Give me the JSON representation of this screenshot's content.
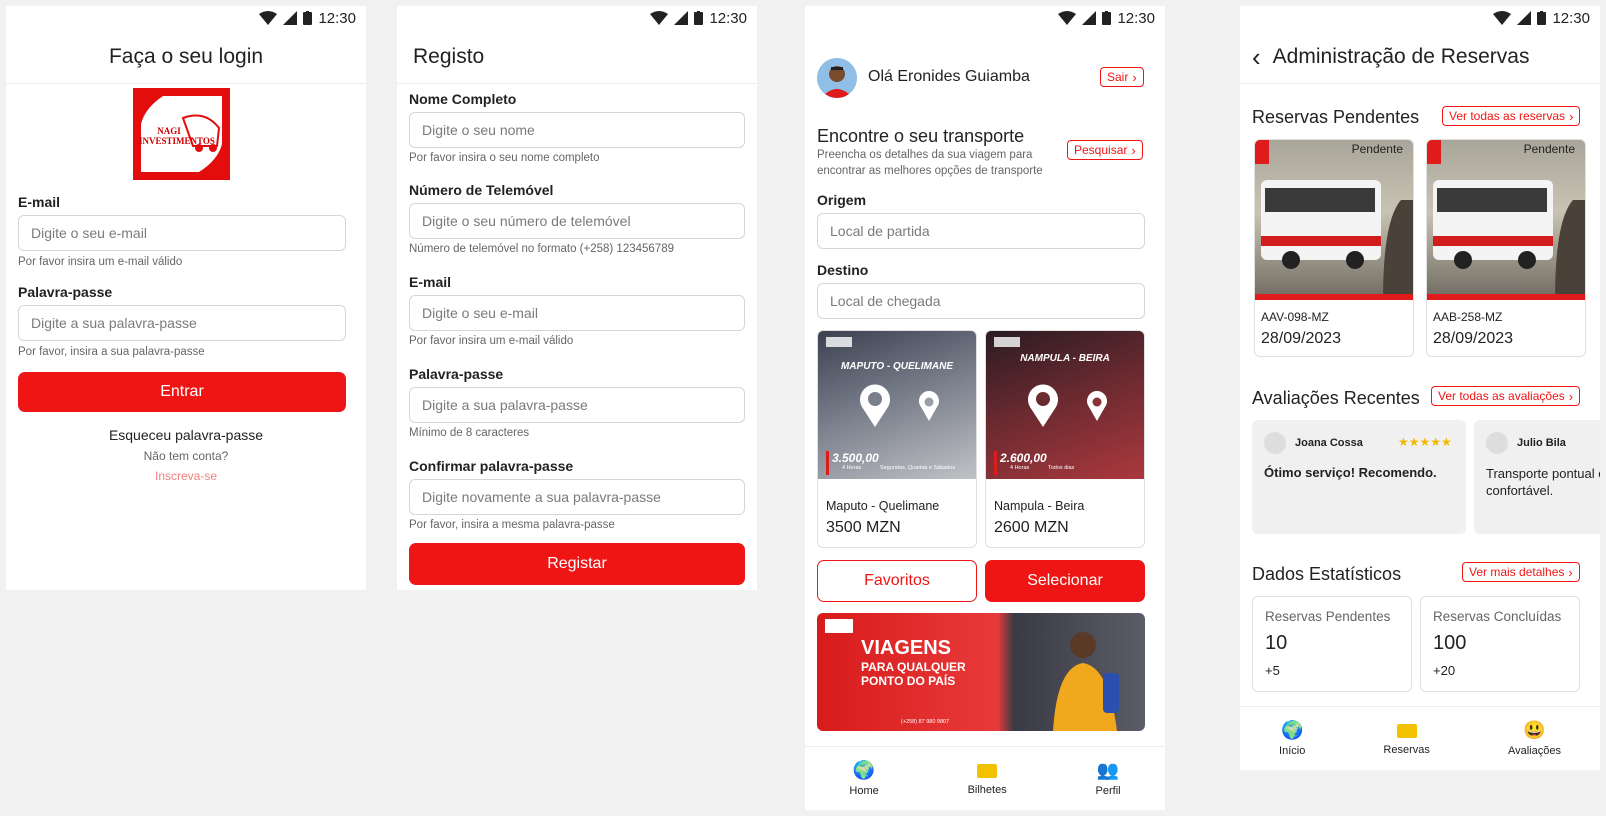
{
  "status": {
    "time": "12:30"
  },
  "login": {
    "title": "Faça o seu login",
    "logo_text": "Nagi Investimentos",
    "email_label": "E-mail",
    "email_placeholder": "Digite o seu e-mail",
    "email_help": "Por favor insira um e-mail válido",
    "password_label": "Palavra-passe",
    "password_placeholder": "Digite a sua palavra-passe",
    "password_help": "Por favor, insira a sua palavra-passe",
    "submit": "Entrar",
    "forgot": "Esqueceu palavra-passe",
    "no_account": "Não tem conta?",
    "signup": "Inscreva-se"
  },
  "register": {
    "title": "Registo",
    "name_label": "Nome Completo",
    "name_placeholder": "Digite o seu nome",
    "name_help": "Por favor insira o seu nome completo",
    "phone_label": "Número de Telemóvel",
    "phone_placeholder": "Digite o seu número de telemóvel",
    "phone_help": "Número de telemóvel no formato (+258) 123456789",
    "email_label": "E-mail",
    "email_placeholder": "Digite o seu e-mail",
    "email_help": "Por favor insira um e-mail válido",
    "password_label": "Palavra-passe",
    "password_placeholder": "Digite a sua palavra-passe",
    "password_help": "Mínimo de 8 caracteres",
    "confirm_label": "Confirmar palavra-passe",
    "confirm_placeholder": "Digite novamente a sua palavra-passe",
    "confirm_help": "Por favor, insira a mesma palavra-passe",
    "submit": "Registar"
  },
  "home": {
    "greeting": "Olá Eronides Guiamba",
    "logout": "Sair",
    "find_title": "Encontre o seu transporte",
    "find_sub": "Preencha os detalhes da sua viagem para encontrar as melhores opções de transporte",
    "search": "Pesquisar",
    "origin_label": "Origem",
    "origin_placeholder": "Local de partida",
    "dest_label": "Destino",
    "dest_placeholder": "Local de chegada",
    "routes": [
      {
        "banner_title": "MAPUTO - QUELIMANE",
        "banner_price": "3.500,00",
        "banner_duration": "4 Horas",
        "banner_days": "Segundas, Quartas e Sábados",
        "name": "Maputo - Quelimane",
        "price": "3500 MZN"
      },
      {
        "banner_title": "NAMPULA - BEIRA",
        "banner_price": "2.600,00",
        "banner_duration": "4 Horas",
        "banner_days": "Todos dias",
        "name": "Nampula - Beira",
        "price": "2600 MZN"
      }
    ],
    "favorites": "Favoritos",
    "select": "Selecionar",
    "promo_line1": "VIAGENS",
    "promo_line2": "PARA QUALQUER",
    "promo_line3": "PONTO DO PAÍS",
    "promo_contact": "(+258) 87 980 9807",
    "nav": [
      {
        "label": "Home",
        "icon": "globe-icon"
      },
      {
        "label": "Bilhetes",
        "icon": "ticket-icon"
      },
      {
        "label": "Perfil",
        "icon": "people-icon"
      }
    ]
  },
  "admin": {
    "title": "Administração de Reservas",
    "pending_title": "Reservas Pendentes",
    "pending_link": "Ver todas as reservas",
    "reservations": [
      {
        "status": "Pendente",
        "plate": "AAV-098-MZ",
        "date": "28/09/2023"
      },
      {
        "status": "Pendente",
        "plate": "AAB-258-MZ",
        "date": "28/09/2023"
      }
    ],
    "reviews_title": "Avaliações Recentes",
    "reviews_link": "Ver todas as avaliações",
    "reviews": [
      {
        "name": "Joana Cossa",
        "stars": "★★★★★",
        "text": "Ótimo serviço! Recomendo."
      },
      {
        "name": "Julio Bila",
        "text": "Transporte pontual e confortável."
      }
    ],
    "stats_title": "Dados Estatísticos",
    "stats_link": "Ver mais detalhes",
    "stats": [
      {
        "label": "Reservas Pendentes",
        "value": "10",
        "delta": "+5"
      },
      {
        "label": "Reservas Concluídas",
        "value": "100",
        "delta": "+20"
      }
    ],
    "nav": [
      {
        "label": "Início",
        "icon": "globe-icon"
      },
      {
        "label": "Reservas",
        "icon": "ticket-icon"
      },
      {
        "label": "Avaliações",
        "icon": "smiley-icon"
      }
    ]
  },
  "colors": {
    "accent": "#ef1515",
    "background": "#f1f1f1"
  }
}
